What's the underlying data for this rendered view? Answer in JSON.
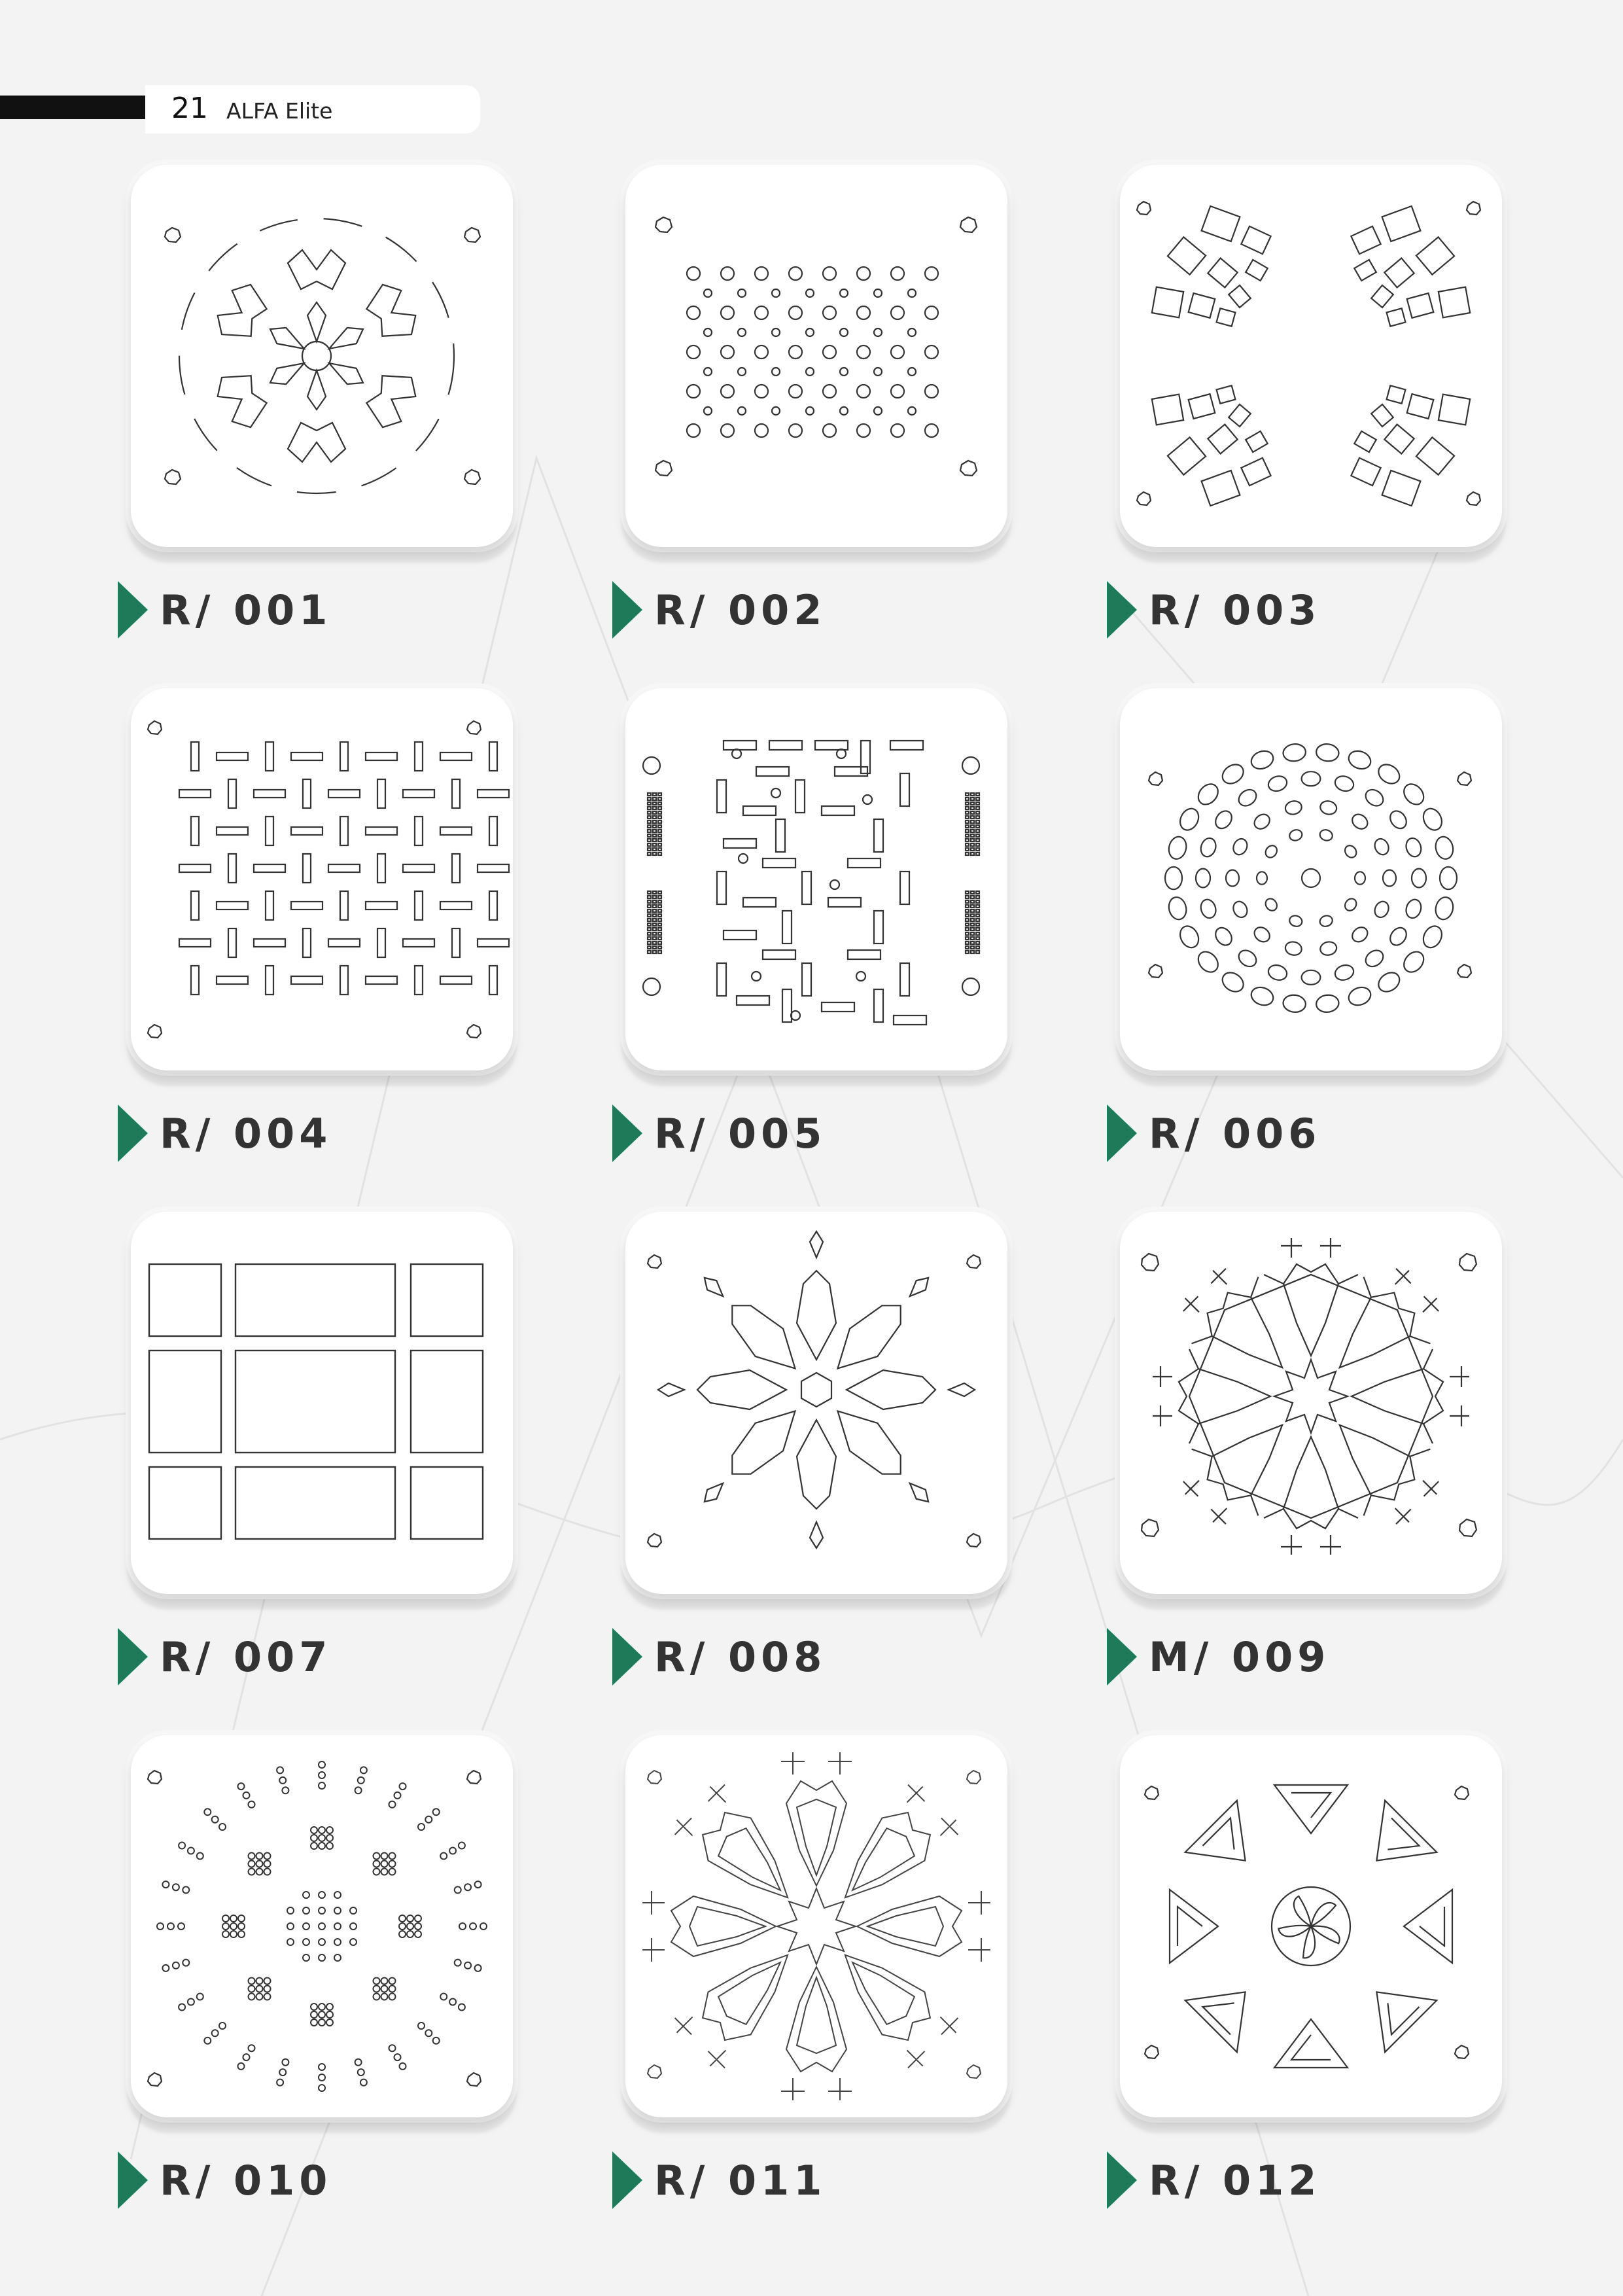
{
  "header": {
    "page_number": "21",
    "brand": "ALFA Elite"
  },
  "accent_color": "#1f7a5a",
  "products": [
    {
      "code": "R/ 001",
      "pattern": "radial-star-cutout"
    },
    {
      "code": "R/ 002",
      "pattern": "circle-perforation"
    },
    {
      "code": "R/ 003",
      "pattern": "square-arcs"
    },
    {
      "code": "R/ 004",
      "pattern": "basketweave-slots"
    },
    {
      "code": "R/ 005",
      "pattern": "maze-slots"
    },
    {
      "code": "R/ 006",
      "pattern": "oval-rings"
    },
    {
      "code": "R/ 007",
      "pattern": "panel-grid"
    },
    {
      "code": "R/ 008",
      "pattern": "kite-star"
    },
    {
      "code": "M/ 009",
      "pattern": "arabesque-star"
    },
    {
      "code": "R/ 010",
      "pattern": "dot-clusters"
    },
    {
      "code": "R/ 011",
      "pattern": "arabesque-star-large"
    },
    {
      "code": "R/ 012",
      "pattern": "triangle-rosette"
    }
  ]
}
